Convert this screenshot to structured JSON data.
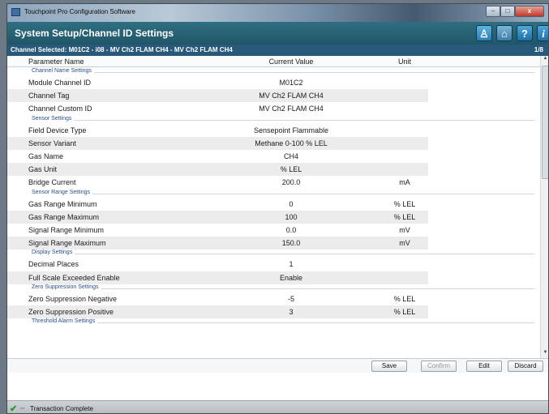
{
  "window": {
    "title": "Touchpoint Pro Configuration Software"
  },
  "header": {
    "title": "System Setup/Channel ID Settings"
  },
  "channel_bar": {
    "selected": "Channel Selected: M01C2 - i08 - MV Ch2 FLAM CH4 - MV Ch2 FLAM CH4",
    "page": "1/8"
  },
  "columns": {
    "name": "Parameter Name",
    "value": "Current Value",
    "unit": "Unit"
  },
  "sections": [
    {
      "title": "Channel Name Settings",
      "rows": [
        {
          "name": "Module Channel ID",
          "value": "M01C2",
          "unit": ""
        },
        {
          "name": "Channel Tag",
          "value": "MV Ch2 FLAM CH4",
          "unit": ""
        },
        {
          "name": "Channel Custom ID",
          "value": "MV Ch2 FLAM CH4",
          "unit": ""
        }
      ]
    },
    {
      "title": "Sensor Settings",
      "rows": [
        {
          "name": "Field Device Type",
          "value": "Sensepoint Flammable",
          "unit": ""
        },
        {
          "name": "Sensor Variant",
          "value": "Methane 0-100 % LEL",
          "unit": ""
        },
        {
          "name": "Gas Name",
          "value": "CH4",
          "unit": ""
        },
        {
          "name": "Gas Unit",
          "value": "% LEL",
          "unit": ""
        },
        {
          "name": "Bridge Current",
          "value": "200.0",
          "unit": "mA"
        }
      ]
    },
    {
      "title": "Sensor Range Settings",
      "rows": [
        {
          "name": "Gas Range Minimum",
          "value": "0",
          "unit": "% LEL"
        },
        {
          "name": "Gas Range Maximum",
          "value": "100",
          "unit": "% LEL"
        },
        {
          "name": "Signal Range Minimum",
          "value": "0.0",
          "unit": "mV"
        },
        {
          "name": "Signal Range Maximum",
          "value": "150.0",
          "unit": "mV"
        }
      ]
    },
    {
      "title": "Display Settings",
      "rows": [
        {
          "name": "Decimal Places",
          "value": "1",
          "unit": ""
        },
        {
          "name": "Full Scale Exceeded Enable",
          "value": "Enable",
          "unit": ""
        }
      ]
    },
    {
      "title": "Zero Suppression Settings",
      "rows": [
        {
          "name": "Zero Suppression Negative",
          "value": "-5",
          "unit": "% LEL"
        },
        {
          "name": "Zero Suppression Positive",
          "value": "3",
          "unit": "% LEL"
        }
      ]
    },
    {
      "title": "Threshold Alarm Settings",
      "rows": []
    }
  ],
  "actions": {
    "save": "Save",
    "confirm": "Confirm",
    "edit": "Edit",
    "discard": "Discard"
  },
  "status": {
    "message": "Transaction Complete"
  },
  "icons": {
    "header": [
      "person-icon",
      "home-icon",
      "help-icon",
      "info-icon"
    ],
    "status": "check-icon"
  },
  "colors": {
    "header_bg": "#2f6f81",
    "channel_bar_bg": "#29597a",
    "section_title": "#2a4f8a",
    "alt_row": "#ececec"
  }
}
